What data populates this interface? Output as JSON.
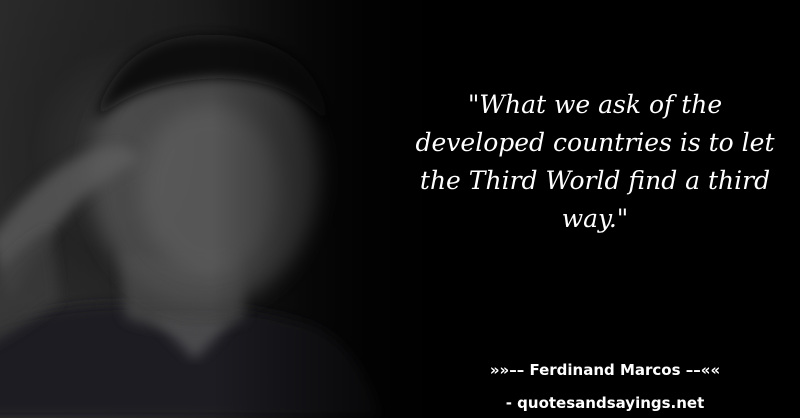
{
  "quote": {
    "text": "\"What we ask of the developed countries is to let the Third World find a third way.\""
  },
  "attribution": {
    "author_line": "»»–– Ferdinand Marcos ––««",
    "source_line": "- quotesandsayings.net"
  },
  "colors": {
    "background": "#000000",
    "text": "#ffffff"
  }
}
